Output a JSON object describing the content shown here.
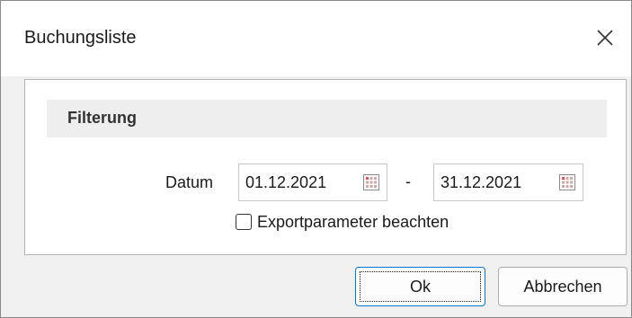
{
  "window": {
    "title": "Buchungsliste",
    "close_icon": "close-icon"
  },
  "filter": {
    "group_title": "Filterung",
    "datum_label": "Datum",
    "date_from": "01.12.2021",
    "separator": "-",
    "date_to": "31.12.2021",
    "calendar_icon": "calendar-icon",
    "export_checkbox_label": "Exportparameter beachten",
    "export_checked": false
  },
  "buttons": {
    "ok_label": "Ok",
    "cancel_label": "Abbrechen"
  },
  "colors": {
    "accent": "#0078d4",
    "panel_bg": "#f0f0f0",
    "group_header_bg": "#eeeeee"
  }
}
